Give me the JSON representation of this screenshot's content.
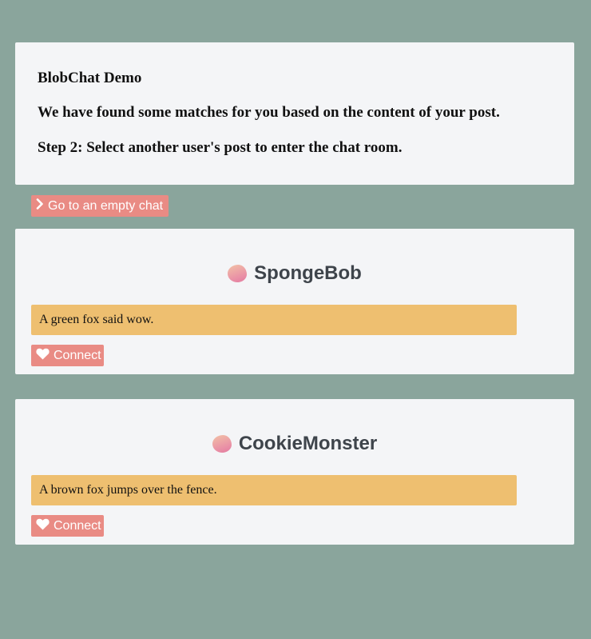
{
  "header": {
    "title": "BlobChat Demo",
    "match_message": "We have found some matches for you based on the content of your post.",
    "step": "Step 2: Select another user's post to enter the chat room."
  },
  "empty_chat_button": {
    "label": "Go to an empty chat",
    "icon": "chevron-right-icon"
  },
  "matches": [
    {
      "username": "SpongeBob",
      "post": "A green fox said wow.",
      "connect_label": "Connect"
    },
    {
      "username": "CookieMonster",
      "post": "A brown fox jumps over the fence.",
      "connect_label": "Connect"
    }
  ],
  "colors": {
    "background": "#8aa59c",
    "card": "#f4f5f7",
    "button": "#e98b84",
    "post_box": "#eebf70"
  }
}
